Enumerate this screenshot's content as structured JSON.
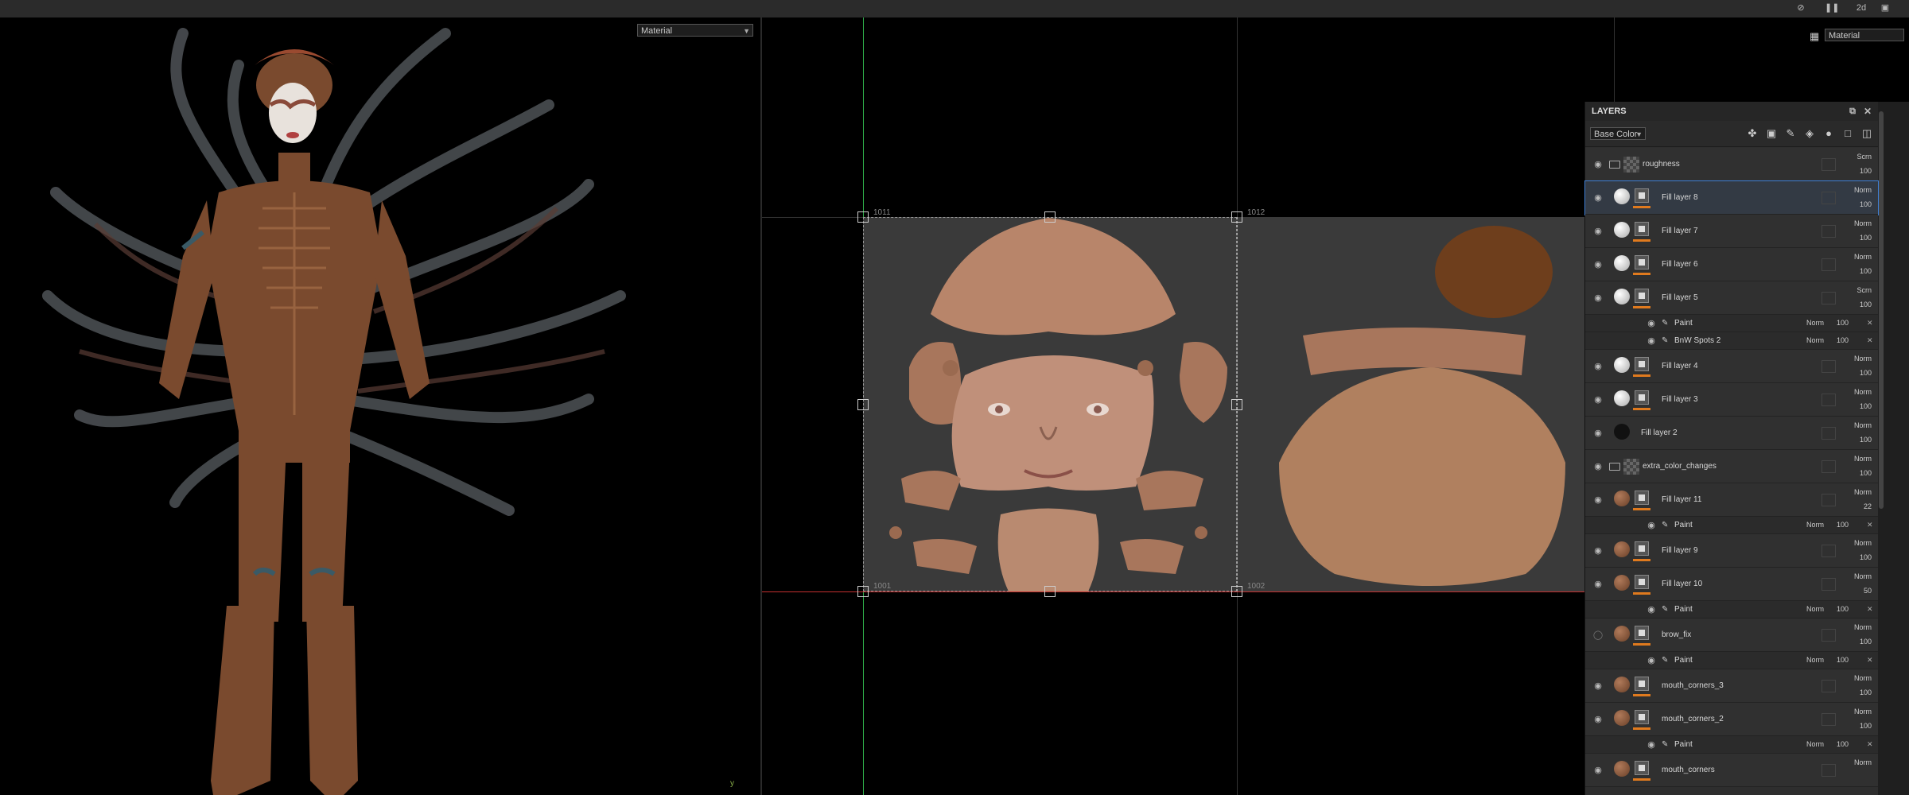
{
  "viewport3d": {
    "mode": "Material",
    "axis": "y"
  },
  "viewport2d": {
    "mode": "Material",
    "tiles": [
      "1011",
      "1012",
      "1001",
      "1002"
    ]
  },
  "topbar": {
    "icons": [
      "visibility-off-icon",
      "pause-icon",
      "camera-icon",
      "cube-icon"
    ],
    "cam_label": "2d"
  },
  "layers": {
    "title": "LAYERS",
    "channel": "Base Color",
    "rows": [
      {
        "name": "roughness",
        "kind": "folder",
        "blend": "Scrn",
        "opacity": "100"
      },
      {
        "name": "Fill layer 8",
        "kind": "fill",
        "blend": "Norm",
        "opacity": "100",
        "selected": true
      },
      {
        "name": "Fill layer 7",
        "kind": "fill",
        "blend": "Norm",
        "opacity": "100"
      },
      {
        "name": "Fill layer 6",
        "kind": "fill",
        "blend": "Norm",
        "opacity": "100"
      },
      {
        "name": "Fill layer 5",
        "kind": "fill",
        "blend": "Scrn",
        "opacity": "100"
      },
      {
        "name": "Paint",
        "kind": "sub",
        "blend": "Norm",
        "opacity": "100"
      },
      {
        "name": "BnW Spots 2",
        "kind": "sub",
        "blend": "Norm",
        "opacity": "100"
      },
      {
        "name": "Fill layer 4",
        "kind": "fill",
        "blend": "Norm",
        "opacity": "100"
      },
      {
        "name": "Fill layer 3",
        "kind": "fill",
        "blend": "Norm",
        "opacity": "100"
      },
      {
        "name": "Fill layer 2",
        "kind": "fill-black",
        "blend": "Norm",
        "opacity": "100"
      },
      {
        "name": "extra_color_changes",
        "kind": "folder",
        "blend": "Norm",
        "opacity": "100"
      },
      {
        "name": "Fill layer 11",
        "kind": "fill-skin",
        "blend": "Norm",
        "opacity": "22"
      },
      {
        "name": "Paint",
        "kind": "sub",
        "blend": "Norm",
        "opacity": "100"
      },
      {
        "name": "Fill layer 9",
        "kind": "fill-skin",
        "blend": "Norm",
        "opacity": "100"
      },
      {
        "name": "Fill layer 10",
        "kind": "fill-skin",
        "blend": "Norm",
        "opacity": "50"
      },
      {
        "name": "Paint",
        "kind": "sub",
        "blend": "Norm",
        "opacity": "100"
      },
      {
        "name": "brow_fix",
        "kind": "fill-skin",
        "blend": "Norm",
        "opacity": "100",
        "hidden": true
      },
      {
        "name": "Paint",
        "kind": "sub",
        "blend": "Norm",
        "opacity": "100"
      },
      {
        "name": "mouth_corners_3",
        "kind": "fill-skin",
        "blend": "Norm",
        "opacity": "100"
      },
      {
        "name": "mouth_corners_2",
        "kind": "fill-skin",
        "blend": "Norm",
        "opacity": "100"
      },
      {
        "name": "Paint",
        "kind": "sub",
        "blend": "Norm",
        "opacity": "100"
      },
      {
        "name": "mouth_corners",
        "kind": "fill-skin",
        "blend": "Norm",
        "opacity": ""
      }
    ]
  },
  "colors": {
    "accent": "#e07a1e",
    "selection": "#3e7fd6",
    "skin": "#b8856a",
    "bronze": "#7a4a2e"
  }
}
